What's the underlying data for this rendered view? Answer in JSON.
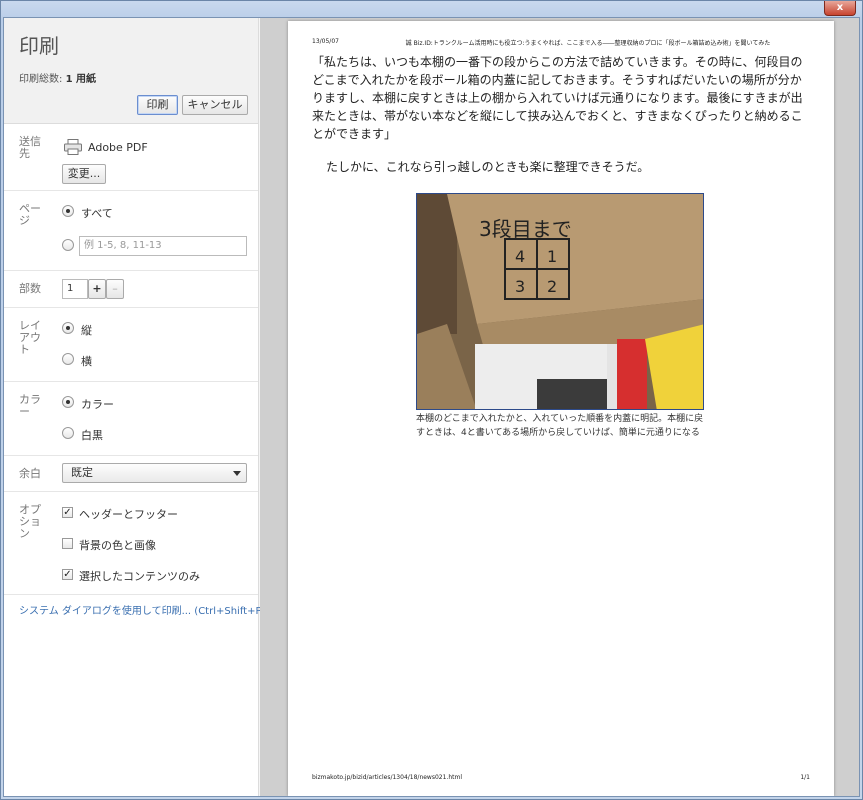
{
  "window": {
    "close_label": "x"
  },
  "sidebar": {
    "title": "印刷",
    "total_label": "印刷総数:",
    "total_value": "1 用紙",
    "print_button": "印刷",
    "cancel_button": "キャンセル",
    "destination": {
      "label": "送信先",
      "printer_name": "Adobe PDF",
      "change_button": "変更..."
    },
    "pages": {
      "label": "ページ",
      "all_option": "すべて",
      "range_placeholder": "例 1-5, 8, 11-13",
      "selected": "all"
    },
    "copies": {
      "label": "部数",
      "value": "1",
      "plus": "+",
      "minus": "–"
    },
    "layout": {
      "label": "レイアウト",
      "portrait": "縦",
      "landscape": "横",
      "selected": "portrait"
    },
    "color": {
      "label": "カラー",
      "color_option": "カラー",
      "bw_option": "白黒",
      "selected": "color"
    },
    "margins": {
      "label": "余白",
      "value": "既定"
    },
    "options": {
      "label": "オプション",
      "headers_footers": "ヘッダーとフッター",
      "headers_footers_checked": true,
      "background": "背景の色と画像",
      "background_checked": false,
      "selection_only": "選択したコンテンツのみ",
      "selection_only_checked": true
    },
    "system_dialog_link": "システム ダイアログを使用して印刷... (Ctrl+Shift+P)"
  },
  "preview": {
    "header_date": "13/05/07",
    "header_title": "誠 Biz.ID:トランクルーム活用時にも役立つ:うまくやれば、ここまで入る――整理収納のプロに「段ボール箱詰め込み術」を聞いてみた",
    "paragraph1": "「私たちは、いつも本棚の一番下の段からこの方法で詰めていきます。その時に、何段目のどこまで入れたかを段ボール箱の内蓋に記しておきます。そうすればだいたいの場所が分かりますし、本棚に戻すときは上の棚から入れていけば元通りになります。最後にすきまが出来たときは、帯がない本などを縦にして挟み込んでおくと、すきまなくぴったりと納めることができます」",
    "paragraph2": "たしかに、これなら引っ越しのときも楽に整理できそうだ。",
    "photo_handwriting": {
      "heading": "3段目まで",
      "cells": [
        "4",
        "1",
        "3",
        "2"
      ]
    },
    "caption": "本棚のどこまで入れたかと、入れていった順番を内蓋に明記。本棚に戻すときは、4と書いてある場所から戻していけば、簡単に元通りになる",
    "footer_url": "bizmakoto.jp/bizid/articles/1304/18/news021.html",
    "footer_page": "1/1"
  },
  "colors": {
    "link": "#3a6fb0",
    "photo_border": "#2d4a8a"
  }
}
